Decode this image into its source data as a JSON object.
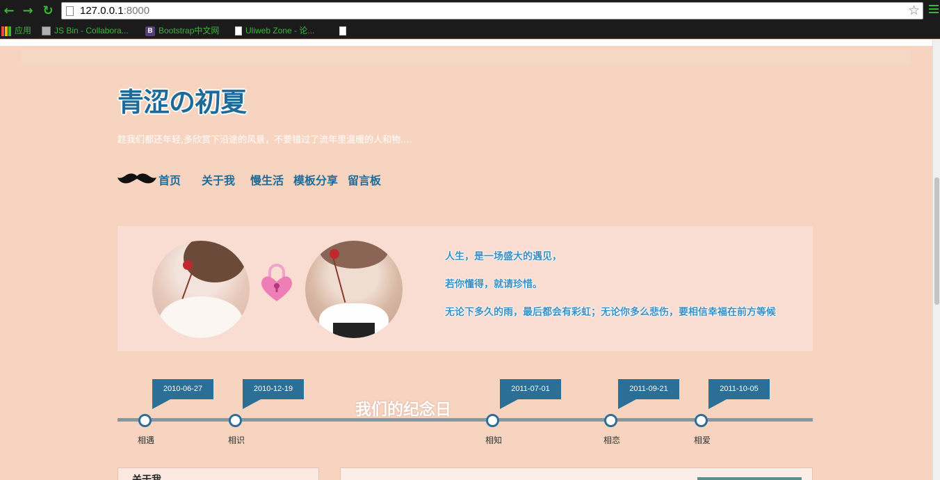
{
  "browser": {
    "url_host": "127.0.0.1",
    "url_port": ":8000",
    "bookmarks": [
      {
        "label": "应用",
        "icon": "apps-grid-icon"
      },
      {
        "label": "JS Bin - Collabora...",
        "icon": "jsbin-icon"
      },
      {
        "label": "Bootstrap中文网",
        "icon": "bootstrap-icon"
      },
      {
        "label": "Uliweb Zone - 论...",
        "icon": "document-icon"
      },
      {
        "label": "",
        "icon": "document-icon"
      }
    ]
  },
  "site": {
    "title": "青涩の初夏",
    "subtitle": "趁我们都还年轻,多欣赏下沿途的风景，不要错过了流年里温暖的人和物....",
    "nav": [
      "首页",
      "关于我",
      "慢生活",
      "模板分享",
      "留言板"
    ]
  },
  "hero": {
    "quotes": [
      "人生，是一场盛大的遇见，",
      "若你懂得，就请珍惜。",
      "无论下多久的雨，最后都会有彩虹；无论你多么悲伤，要相信幸福在前方等候"
    ]
  },
  "timeline": {
    "title": "我们的纪念日",
    "events": [
      {
        "date": "2010-06-27",
        "label": "相遇"
      },
      {
        "date": "2010-12-19",
        "label": "相识"
      },
      {
        "date": "2011-07-01",
        "label": "相知"
      },
      {
        "date": "2011-09-21",
        "label": "相恋"
      },
      {
        "date": "2011-10-05",
        "label": "相爱"
      }
    ]
  },
  "panels": {
    "about_title": "关于我"
  },
  "colors": {
    "background": "#f7d4bf",
    "accent": "#1e6b9a",
    "timeline": "#2b6f97"
  }
}
